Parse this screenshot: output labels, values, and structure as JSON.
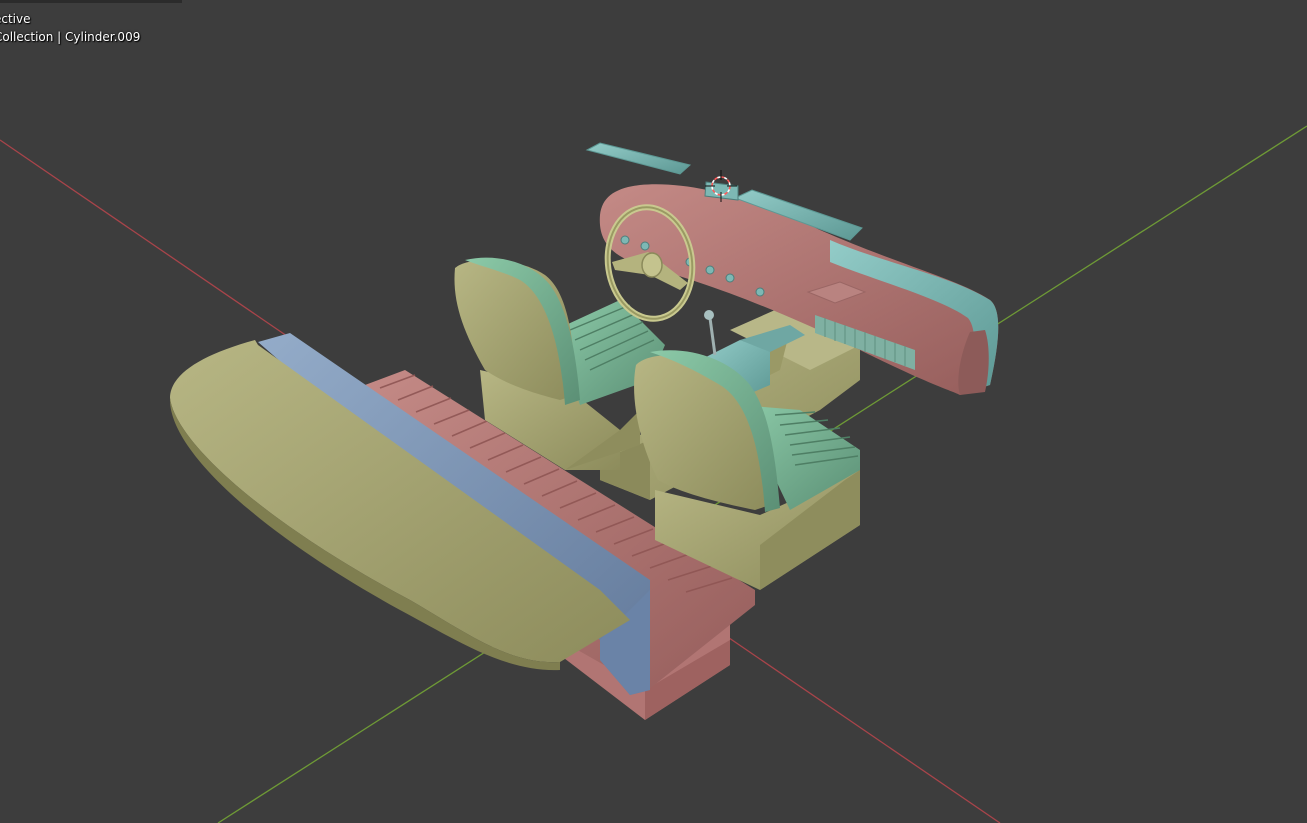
{
  "viewport": {
    "view_mode_text": "ective",
    "collection_text": "Collection | Cylinder.009"
  },
  "colors": {
    "background": "#3d3d3d",
    "axis_x": "#a8444a",
    "axis_y": "#6e9a36",
    "mat_yellow": "#a9a873",
    "mat_green": "#79b293",
    "mat_pink": "#b37a78",
    "mat_blue": "#7d96b8",
    "mat_teal": "#7db8b4"
  },
  "scene_objects": [
    {
      "name": "rear-bench-seat"
    },
    {
      "name": "front-seat-left"
    },
    {
      "name": "front-seat-right"
    },
    {
      "name": "dashboard"
    },
    {
      "name": "steering-wheel"
    },
    {
      "name": "gear-shifter"
    },
    {
      "name": "center-console"
    },
    {
      "name": "sun-visor-left"
    },
    {
      "name": "sun-visor-right"
    },
    {
      "name": "rearview-mirror"
    },
    {
      "name": "3d-cursor"
    }
  ]
}
